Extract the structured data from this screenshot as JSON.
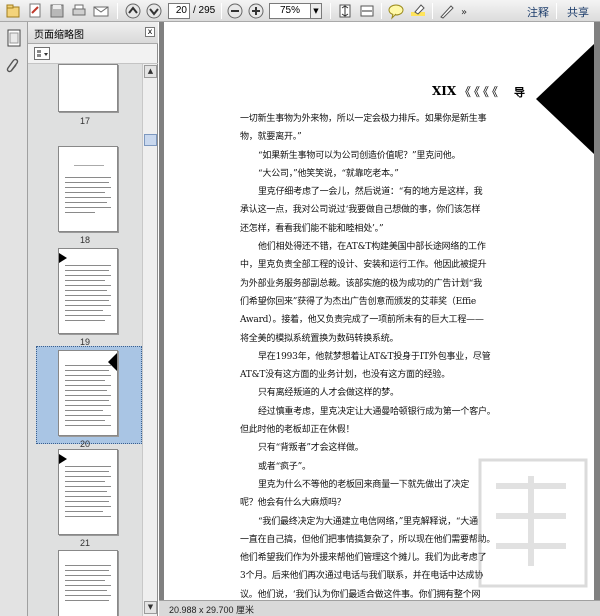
{
  "toolbar": {
    "page_current": "20",
    "page_total": "/ 295",
    "zoom": "75%",
    "comment_label": "注释",
    "share_label": "共享"
  },
  "panel": {
    "title": "页面缩略图",
    "close": "x"
  },
  "thumbnails": [
    {
      "label": "17"
    },
    {
      "label": "18"
    },
    {
      "label": "19"
    },
    {
      "label": "20"
    },
    {
      "label": "21"
    }
  ],
  "document": {
    "page_header": "XIX",
    "header_deco": "《《《《",
    "header_sub": "导",
    "paragraphs": [
      {
        "indent": false,
        "text": "一切新生事物为外来物，所以一定会极力排斥。如果你是新生事"
      },
      {
        "indent": false,
        "text": "物，就要离开。”"
      },
      {
        "indent": true,
        "text": "“如果新生事物可以为公司创造价值呢？”里克问他。"
      },
      {
        "indent": true,
        "text": "“大公司，”他笑笑说，“就靠吃老本。”"
      },
      {
        "indent": true,
        "text": "里克仔细考虑了一会儿，然后说道：“有的地方是这样，我"
      },
      {
        "indent": false,
        "text": "承认这一点，我对公司说过‘我要做自己想做的事，你们该怎样"
      },
      {
        "indent": false,
        "text": "还怎样，看看我们能不能和睦相处’。”"
      },
      {
        "indent": true,
        "text": "他们相处得还不错，在AT&T构建美国中部长途网络的工作"
      },
      {
        "indent": false,
        "text": "中，里克负责全部工程的设计、安装和运行工作。他因此被提升"
      },
      {
        "indent": false,
        "text": "为外部业务服务部副总裁。该部实施的极为成功的广告计划“我"
      },
      {
        "indent": false,
        "text": "们希望你回来”获得了为杰出广告创意而颁发的艾菲奖（Effie"
      },
      {
        "indent": false,
        "text": "Award）。接着，他又负责完成了一项前所未有的巨大工程——"
      },
      {
        "indent": false,
        "text": "将全美的模拟系统置换为数码转换系统。"
      },
      {
        "indent": true,
        "text": "早在1993年，他就梦想着让AT&T投身于IT外包事业，尽管"
      },
      {
        "indent": false,
        "text": "AT&T没有这方面的业务计划，也没有这方面的经验。"
      },
      {
        "indent": true,
        "text": "只有离经叛道的人才会做这样的梦。"
      },
      {
        "indent": true,
        "text": "经过慎重考虑，里克决定让大通曼哈顿银行成为第一个客户。"
      },
      {
        "indent": false,
        "text": "但此时他的老板却正在休假！"
      },
      {
        "indent": true,
        "text": "只有“背叛者”才会这样做。"
      },
      {
        "indent": true,
        "text": "或者“疯子”。"
      },
      {
        "indent": true,
        "text": "里克为什么不等他的老板回来商量一下就先做出了决定"
      },
      {
        "indent": false,
        "text": "呢？他会有什么大麻烦吗？"
      },
      {
        "indent": true,
        "text": "“我们最终决定为大通建立电信网络，”里克解释说，“大通"
      },
      {
        "indent": false,
        "text": "一直在自己搞，但他们把事情搞复杂了，所以现在他们需要帮助。"
      },
      {
        "indent": false,
        "text": "他们希望我们作为外援来帮他们管理这个摊儿。我们为此考虑了"
      },
      {
        "indent": false,
        "text": "3个月。后来他们再次通过电话与我们联系，并在电话中达成协"
      },
      {
        "indent": false,
        "text": "议。他们说，‘我们认为你们最适合做这件事。你们拥有整个网"
      },
      {
        "indent": false,
        "text": "络系统，你们的技术远远超过了我们，你们还出版了网络管理方"
      }
    ]
  },
  "status": {
    "page_size": "20.988 x 29.700 厘米"
  },
  "colors": {
    "selection": "#a9c5e4",
    "toolbar_link": "#1d3d6b",
    "doc_background": "#808080"
  }
}
